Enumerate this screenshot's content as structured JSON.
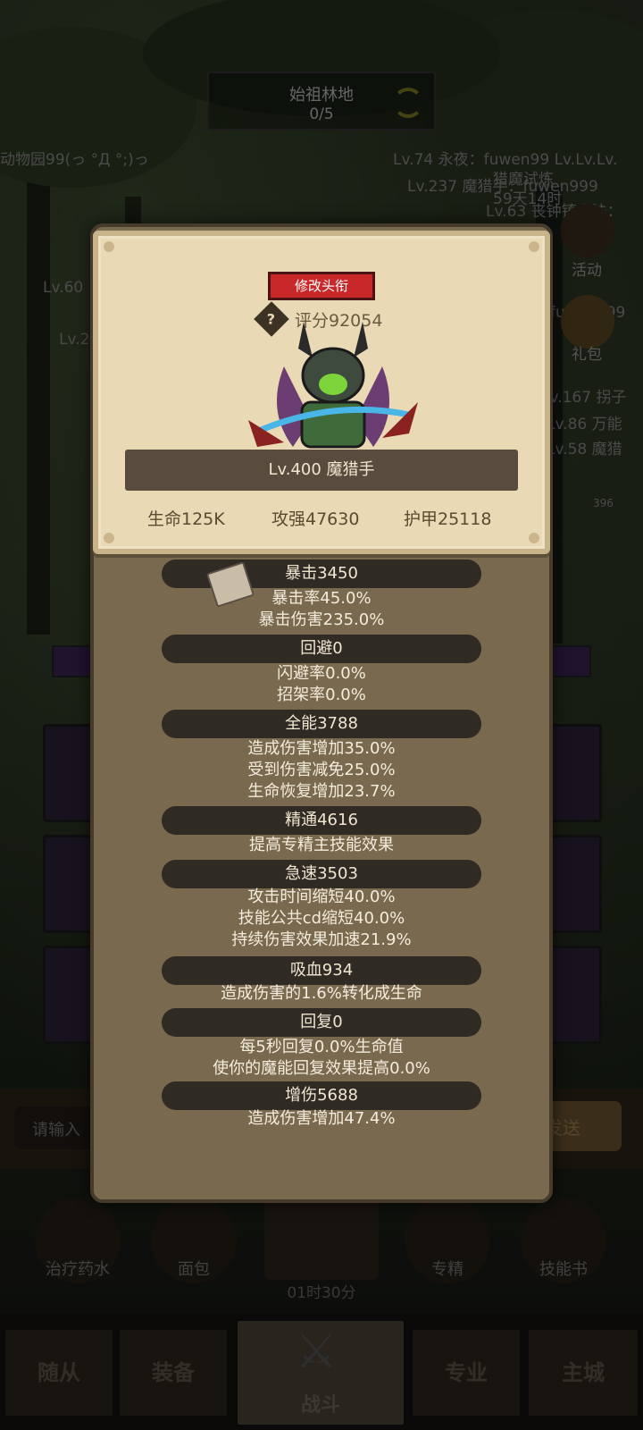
{
  "zone": {
    "name": "始祖林地",
    "progress": "0/5"
  },
  "background_texts": {
    "zoo": "动物园99(っ °Д °;)っ",
    "line1": "Lv.74 永夜：fuwen99 Lv.Lv.Lv.",
    "line2": "猎魔试炼",
    "line3": "Lv.237 魔猎手：fuwen999",
    "line4": "59天14时",
    "line5": "Lv.63 丧钟镇小法：",
    "lv60": "Lv.60",
    "lv2": "Lv.2",
    "fuwen": "fuwen999",
    "lv167": "Lv.167 拐子",
    "lv86": "Lv.86 万能",
    "lv58": "Lv.58 魔猎",
    "badge": "396",
    "activity": "活动",
    "gift": "礼包"
  },
  "chat": {
    "placeholder": "请输入",
    "send": "发送"
  },
  "consumables": [
    {
      "label": "治疗药水",
      "icon": "potion-icon"
    },
    {
      "label": "面包",
      "icon": "bread-icon"
    },
    {
      "label": "专精",
      "icon": "spec-icon"
    },
    {
      "label": "技能书",
      "icon": "skillbook-icon"
    }
  ],
  "timer": "01时30分",
  "nav": {
    "tabs": [
      "随从",
      "装备",
      "战斗",
      "专业",
      "主城"
    ],
    "active": "战斗"
  },
  "profile": {
    "edit_title_button": "修改头衔",
    "score": "评分92054",
    "name": "Lv.400 魔猎手",
    "hp": "生命125K",
    "attack": "攻强47630",
    "armor": "护甲25118"
  },
  "stat_groups": [
    {
      "header": "暴击3450",
      "lines": [
        "暴击率45.0%",
        "暴击伤害235.0%"
      ]
    },
    {
      "header": "回避0",
      "lines": [
        "闪避率0.0%",
        "招架率0.0%"
      ]
    },
    {
      "header": "全能3788",
      "lines": [
        "造成伤害增加35.0%",
        "受到伤害减免25.0%",
        "生命恢复增加23.7%"
      ]
    },
    {
      "header": "精通4616",
      "lines": [
        "提高专精主技能效果"
      ]
    },
    {
      "header": "急速3503",
      "lines": [
        "攻击时间缩短40.0%",
        "技能公共cd缩短40.0%",
        "持续伤害效果加速21.9%"
      ]
    },
    {
      "header": "吸血934",
      "lines": [
        "造成伤害的1.6%转化成生命"
      ]
    },
    {
      "header": "回复0",
      "lines": [
        "每5秒回复0.0%生命值",
        "使你的魔能回复效果提高0.0%"
      ]
    },
    {
      "header": "增伤5688",
      "lines": [
        "造成伤害增加47.4%"
      ]
    }
  ]
}
